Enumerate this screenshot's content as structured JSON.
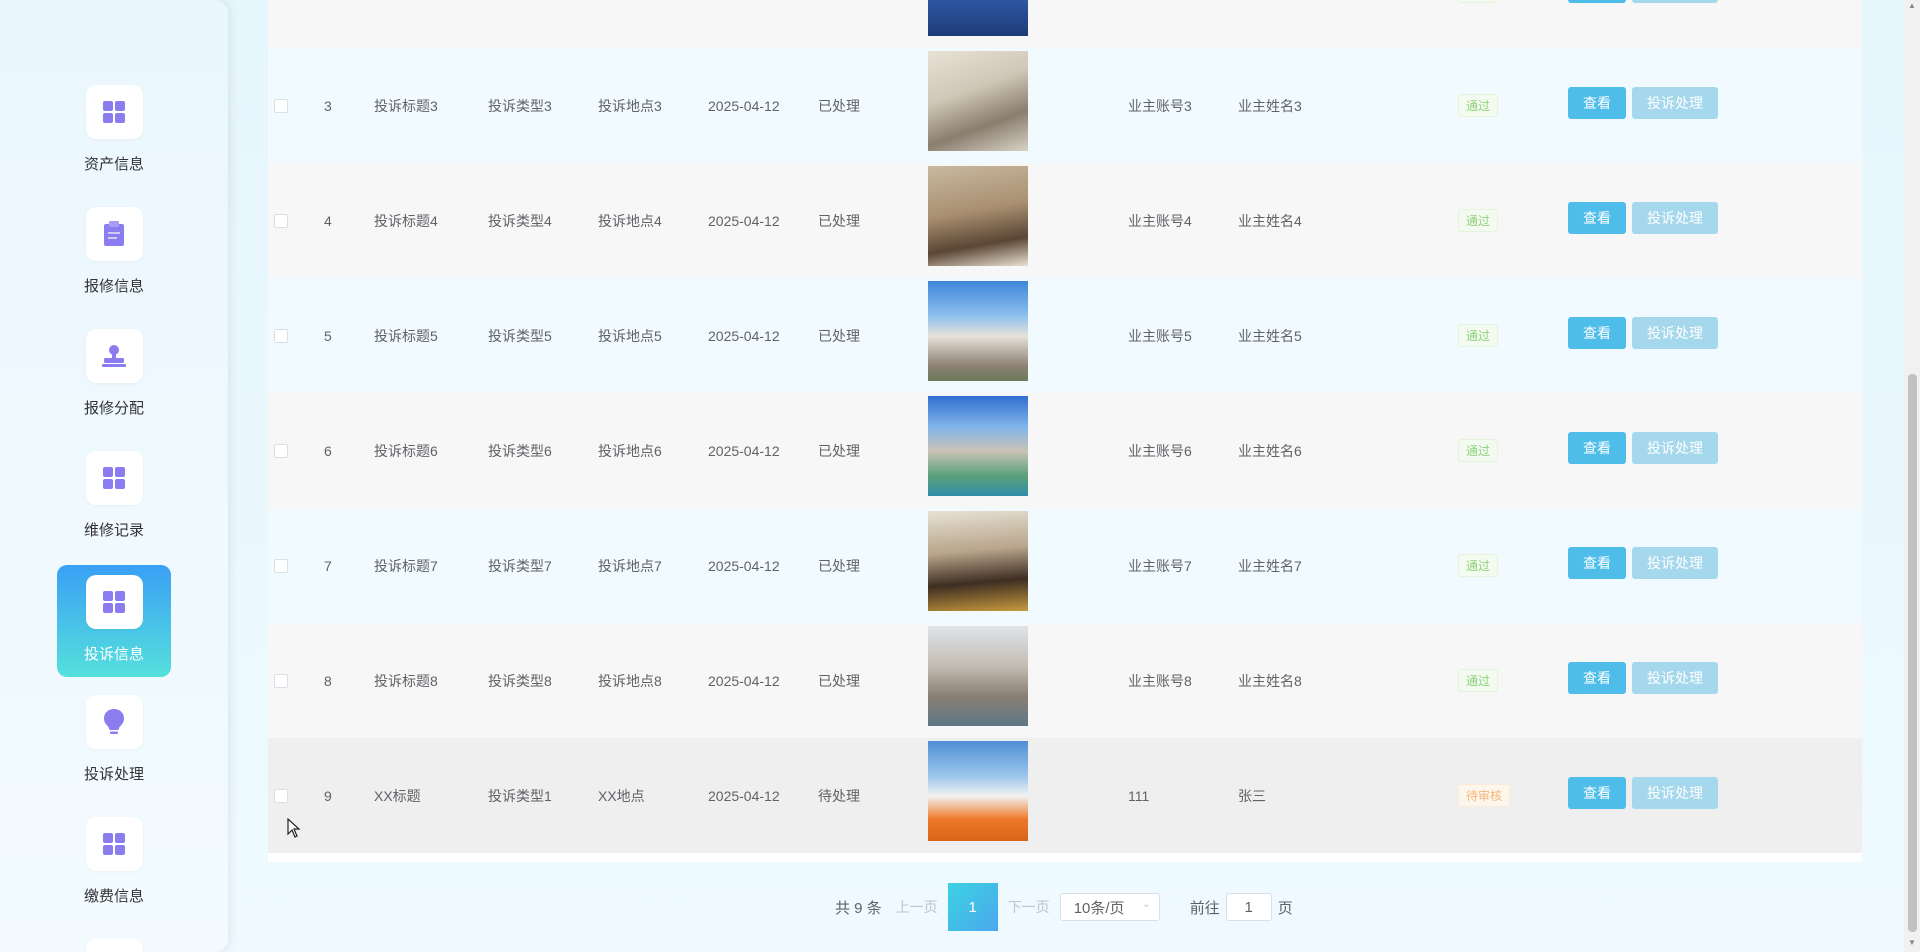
{
  "sidebar": {
    "items": [
      {
        "label": "资产信息",
        "icon": "grid-icon",
        "active": false
      },
      {
        "label": "报修信息",
        "icon": "clipboard-icon",
        "active": false
      },
      {
        "label": "报修分配",
        "icon": "stamp-icon",
        "active": false
      },
      {
        "label": "维修记录",
        "icon": "grid-icon",
        "active": false
      },
      {
        "label": "投诉信息",
        "icon": "grid-icon",
        "active": true
      },
      {
        "label": "投诉处理",
        "icon": "bulb-icon",
        "active": false
      },
      {
        "label": "缴费信息",
        "icon": "grid-icon",
        "active": false
      }
    ]
  },
  "table": {
    "rows": [
      {
        "index": "3",
        "title": "投诉标题3",
        "type": "投诉类型3",
        "location": "投诉地点3",
        "date": "2025-04-12",
        "status": "已处理",
        "account": "业主账号3",
        "name": "业主姓名3",
        "review": "通过",
        "review_kind": "pass"
      },
      {
        "index": "4",
        "title": "投诉标题4",
        "type": "投诉类型4",
        "location": "投诉地点4",
        "date": "2025-04-12",
        "status": "已处理",
        "account": "业主账号4",
        "name": "业主姓名4",
        "review": "通过",
        "review_kind": "pass"
      },
      {
        "index": "5",
        "title": "投诉标题5",
        "type": "投诉类型5",
        "location": "投诉地点5",
        "date": "2025-04-12",
        "status": "已处理",
        "account": "业主账号5",
        "name": "业主姓名5",
        "review": "通过",
        "review_kind": "pass"
      },
      {
        "index": "6",
        "title": "投诉标题6",
        "type": "投诉类型6",
        "location": "投诉地点6",
        "date": "2025-04-12",
        "status": "已处理",
        "account": "业主账号6",
        "name": "业主姓名6",
        "review": "通过",
        "review_kind": "pass"
      },
      {
        "index": "7",
        "title": "投诉标题7",
        "type": "投诉类型7",
        "location": "投诉地点7",
        "date": "2025-04-12",
        "status": "已处理",
        "account": "业主账号7",
        "name": "业主姓名7",
        "review": "通过",
        "review_kind": "pass"
      },
      {
        "index": "8",
        "title": "投诉标题8",
        "type": "投诉类型8",
        "location": "投诉地点8",
        "date": "2025-04-12",
        "status": "已处理",
        "account": "业主账号8",
        "name": "业主姓名8",
        "review": "通过",
        "review_kind": "pass"
      },
      {
        "index": "9",
        "title": "XX标题",
        "type": "投诉类型1",
        "location": "XX地点",
        "date": "2025-04-12",
        "status": "待处理",
        "account": "111",
        "name": "张三",
        "review": "待审核",
        "review_kind": "pending"
      }
    ],
    "view_label": "查看",
    "handle_label": "投诉处理"
  },
  "pagination": {
    "total": "共 9 条",
    "prev": "上一页",
    "current": "1",
    "next": "下一页",
    "page_size": "10条/页",
    "goto_prefix": "前往",
    "goto_value": "1",
    "goto_suffix": "页"
  },
  "colors": {
    "primary": "#4fbde9",
    "secondary": "#a5d8ec",
    "active_menu_start": "#3aa0f5",
    "active_menu_end": "#55e0dc",
    "icon_purple": "#8b7cf0"
  }
}
